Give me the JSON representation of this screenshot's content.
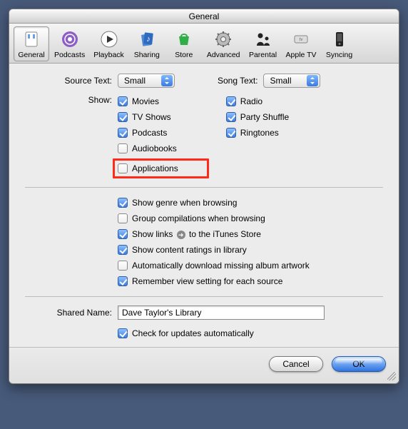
{
  "window": {
    "title": "General"
  },
  "toolbar": {
    "items": [
      {
        "label": "General",
        "selected": true
      },
      {
        "label": "Podcasts",
        "selected": false
      },
      {
        "label": "Playback",
        "selected": false
      },
      {
        "label": "Sharing",
        "selected": false
      },
      {
        "label": "Store",
        "selected": false
      },
      {
        "label": "Advanced",
        "selected": false
      },
      {
        "label": "Parental",
        "selected": false
      },
      {
        "label": "Apple TV",
        "selected": false
      },
      {
        "label": "Syncing",
        "selected": false
      }
    ]
  },
  "text_size": {
    "source_label": "Source Text:",
    "source_value": "Small",
    "song_label": "Song Text:",
    "song_value": "Small"
  },
  "show": {
    "label": "Show:",
    "left": [
      {
        "label": "Movies",
        "checked": true,
        "highlighted": false
      },
      {
        "label": "TV Shows",
        "checked": true,
        "highlighted": false
      },
      {
        "label": "Podcasts",
        "checked": true,
        "highlighted": false
      },
      {
        "label": "Audiobooks",
        "checked": false,
        "highlighted": false
      },
      {
        "label": "Applications",
        "checked": false,
        "highlighted": true
      }
    ],
    "right": [
      {
        "label": "Radio",
        "checked": true
      },
      {
        "label": "Party Shuffle",
        "checked": true
      },
      {
        "label": "Ringtones",
        "checked": true
      }
    ]
  },
  "options": [
    {
      "label": "Show genre when browsing",
      "checked": true,
      "store_link": false
    },
    {
      "label": "Group compilations when browsing",
      "checked": false,
      "store_link": false
    },
    {
      "label_pre": "Show links ",
      "label_post": " to the iTunes Store",
      "checked": true,
      "store_link": true
    },
    {
      "label": "Show content ratings in library",
      "checked": true,
      "store_link": false
    },
    {
      "label": "Automatically download missing album artwork",
      "checked": false,
      "store_link": false
    },
    {
      "label": "Remember view setting for each source",
      "checked": true,
      "store_link": false
    }
  ],
  "shared": {
    "label": "Shared Name:",
    "value": "Dave Taylor's Library"
  },
  "updates": {
    "label": "Check for updates automatically",
    "checked": true
  },
  "buttons": {
    "cancel": "Cancel",
    "ok": "OK"
  },
  "highlight_color": "#ff2a1a"
}
